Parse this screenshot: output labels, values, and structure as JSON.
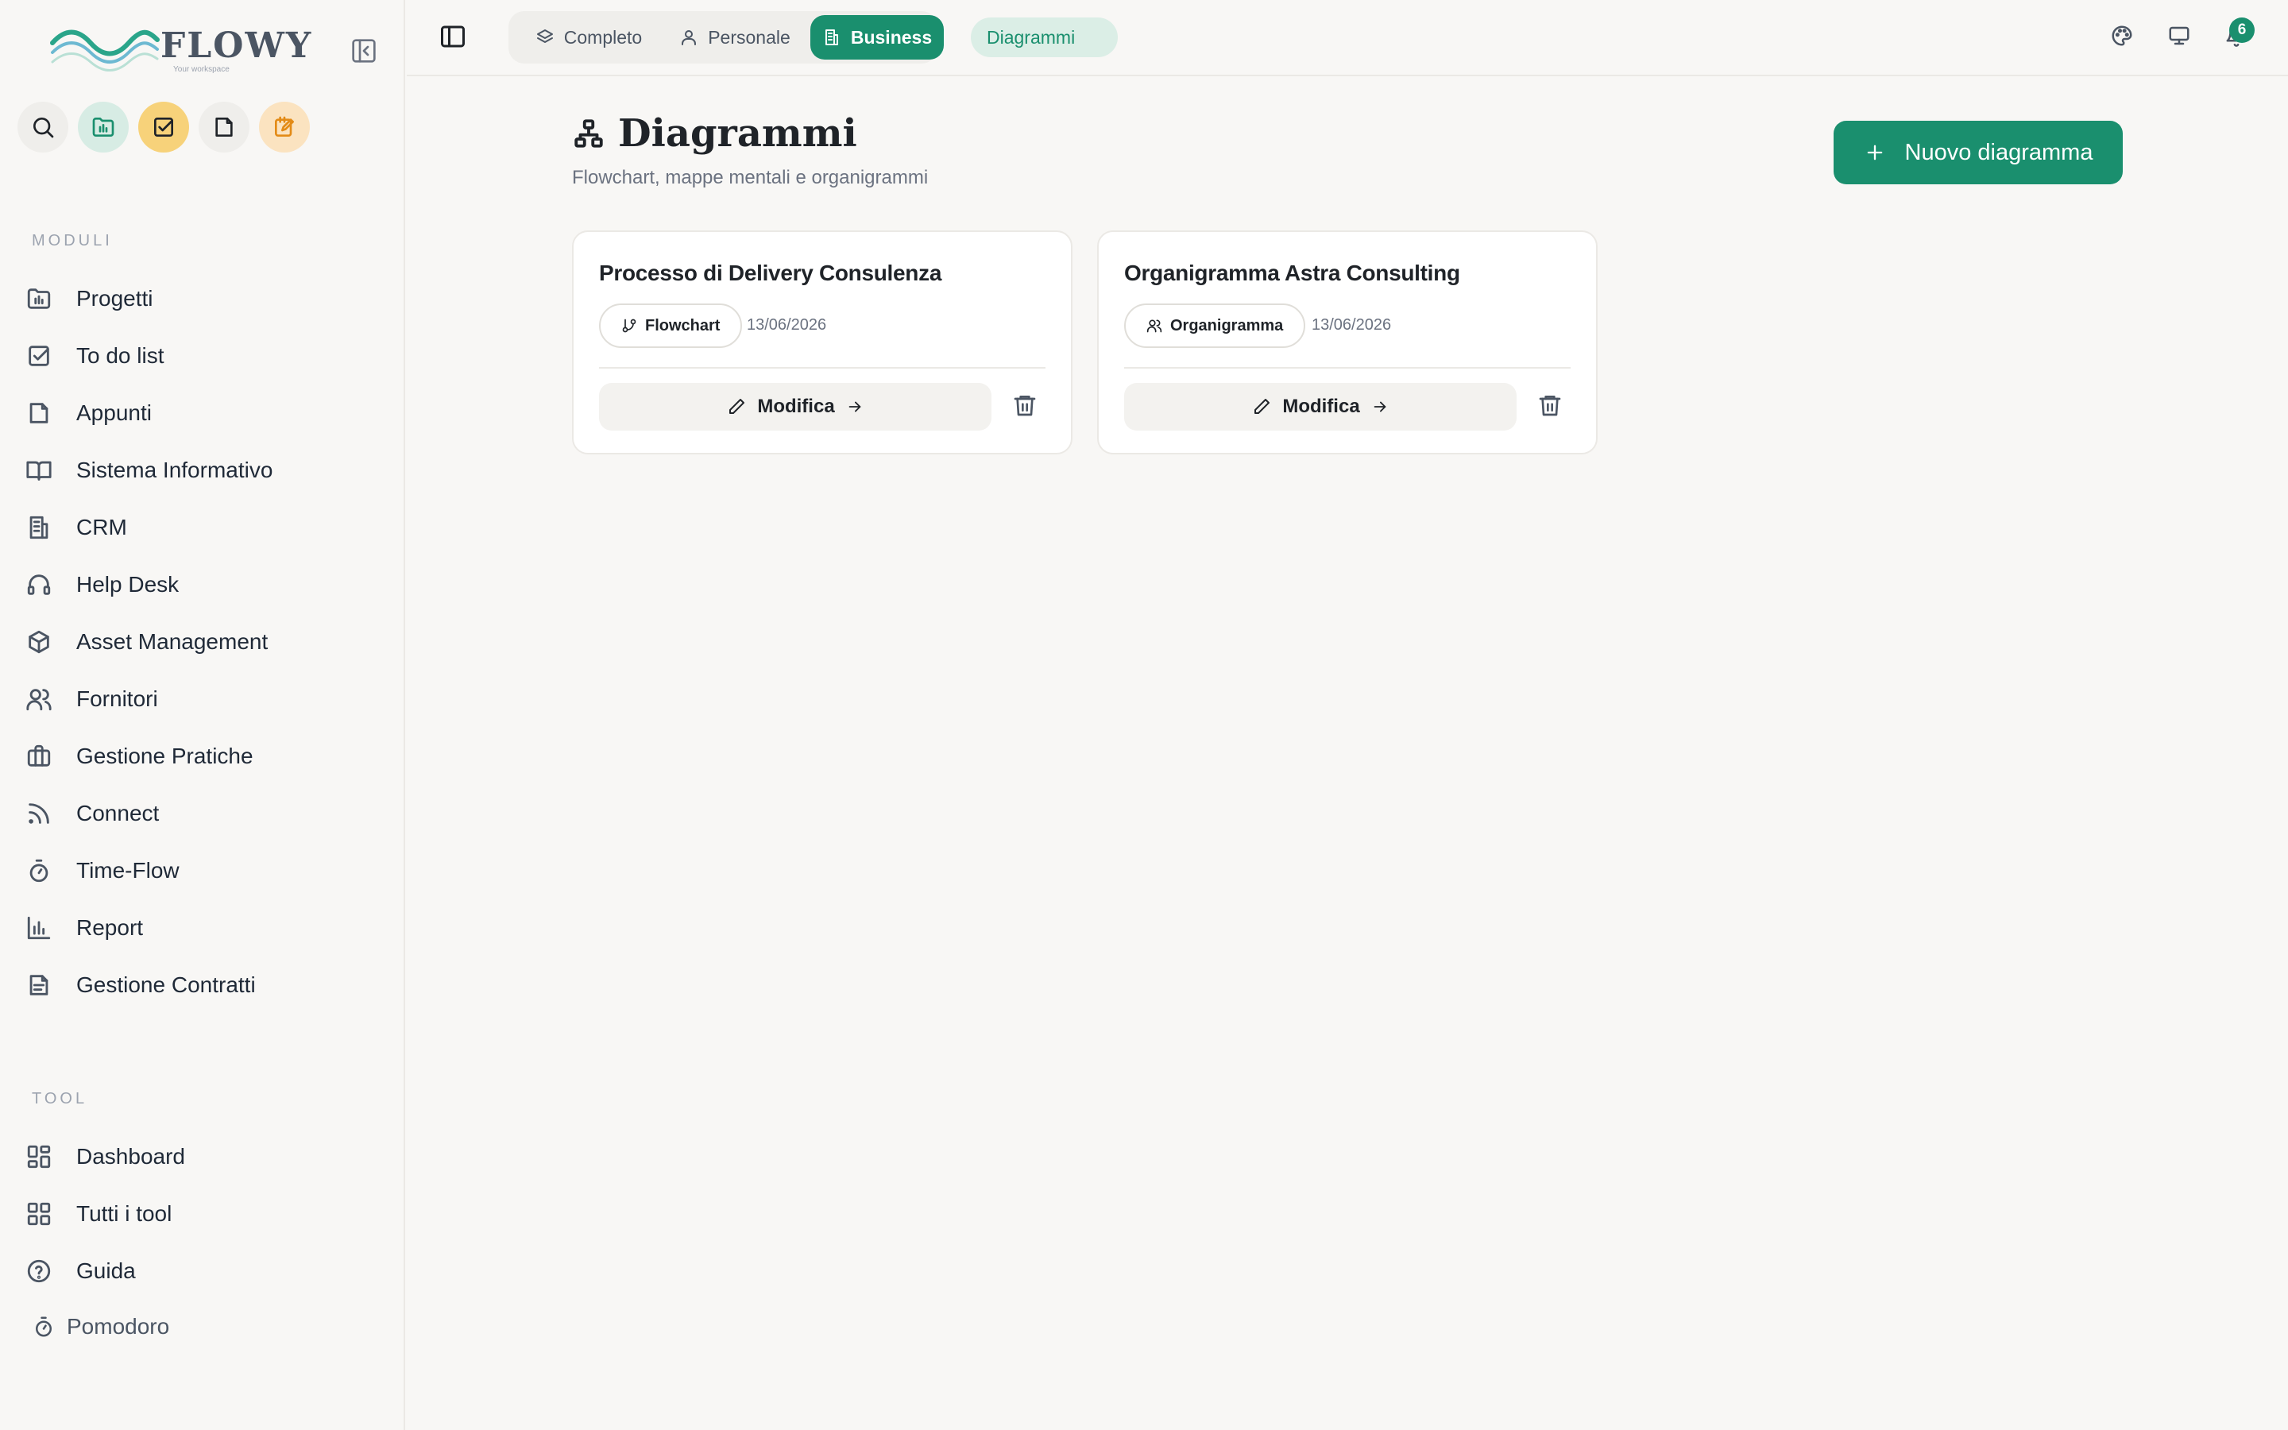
{
  "app": {
    "logo_text": "FLOWY",
    "logo_sub": "Your workspace"
  },
  "sidebar": {
    "quick_actions": [
      "search-icon",
      "projects-folder-icon",
      "todo-check-icon",
      "note-file-icon",
      "edit-note-icon"
    ],
    "modules_label": "MODULI",
    "modules": [
      {
        "label": "Progetti",
        "icon": "folder-chart-icon"
      },
      {
        "label": "To do list",
        "icon": "check-square-icon"
      },
      {
        "label": "Appunti",
        "icon": "file-icon"
      },
      {
        "label": "Sistema Informativo",
        "icon": "book-open-icon"
      },
      {
        "label": "CRM",
        "icon": "building-icon"
      },
      {
        "label": "Help Desk",
        "icon": "headset-icon"
      },
      {
        "label": "Asset Management",
        "icon": "package-icon"
      },
      {
        "label": "Fornitori",
        "icon": "users-icon"
      },
      {
        "label": "Gestione Pratiche",
        "icon": "briefcase-icon"
      },
      {
        "label": "Connect",
        "icon": "rss-icon"
      },
      {
        "label": "Time-Flow",
        "icon": "timer-icon"
      },
      {
        "label": "Report",
        "icon": "bar-chart-icon"
      },
      {
        "label": "Gestione Contratti",
        "icon": "file-text-icon"
      }
    ],
    "tool_label": "TOOL",
    "tools": [
      {
        "label": "Dashboard",
        "icon": "dashboard-icon"
      },
      {
        "label": "Tutti i tool",
        "icon": "grid-icon"
      },
      {
        "label": "Guida",
        "icon": "help-circle-icon"
      }
    ],
    "pomodoro": "Pomodoro"
  },
  "topbar": {
    "tabs": [
      {
        "label": "Completo",
        "icon": "layers-icon",
        "active": false
      },
      {
        "label": "Personale",
        "icon": "user-icon",
        "active": false
      },
      {
        "label": "Business",
        "icon": "building-icon",
        "active": true
      }
    ],
    "breadcrumb": "Diagrammi",
    "notification_count": "6"
  },
  "main": {
    "title": "Diagrammi",
    "subtitle": "Flowchart, mappe mentali e organigrammi",
    "new_button": "Nuovo diagramma",
    "cards": [
      {
        "title": "Processo di Delivery Consulenza",
        "type": "Flowchart",
        "date": "13/06/2026",
        "edit": "Modifica"
      },
      {
        "title": "Organigramma Astra Consulting",
        "type": "Organigramma",
        "date": "13/06/2026",
        "edit": "Modifica"
      }
    ]
  },
  "colors": {
    "accent": "#1a8f6e",
    "accent_light": "#dbeee6",
    "background": "#f8f7f5"
  }
}
